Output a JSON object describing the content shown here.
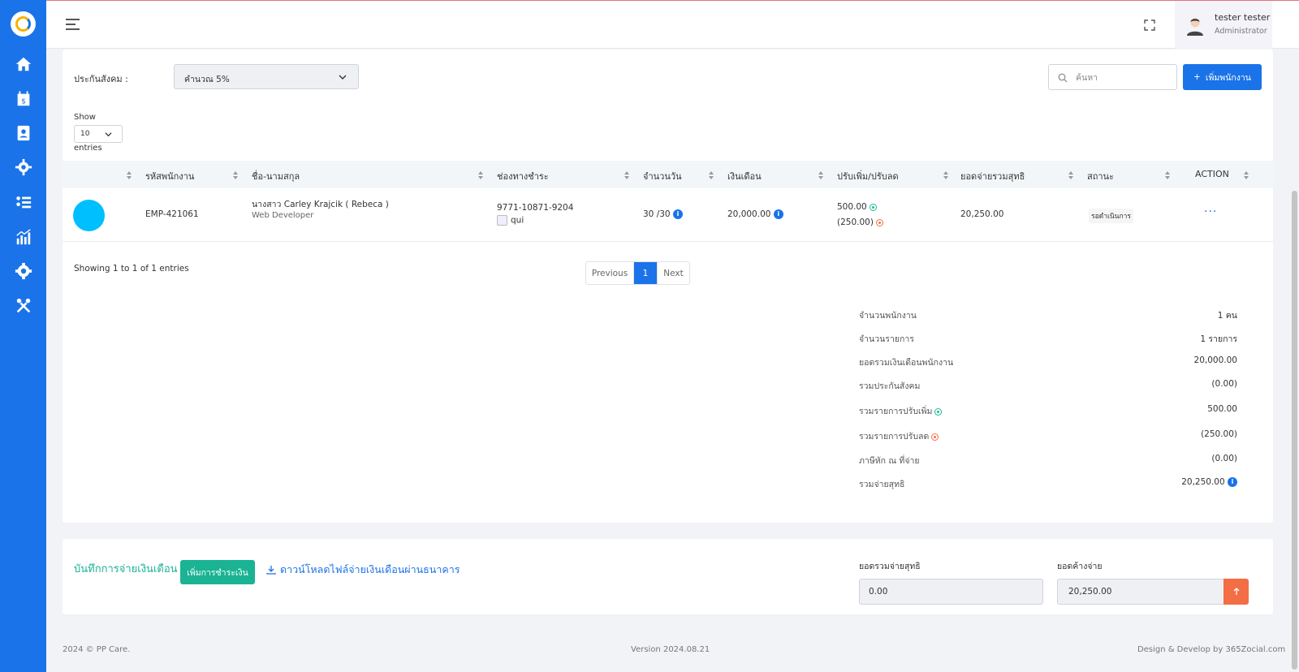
{
  "header": {
    "user_name": "tester tester",
    "user_role": "Administrator"
  },
  "sidebar": {
    "items": [
      {
        "icon": "home-icon"
      },
      {
        "icon": "salary-calendar-icon"
      },
      {
        "icon": "contacts-icon"
      },
      {
        "icon": "gears-icon"
      },
      {
        "icon": "list-users-icon"
      },
      {
        "icon": "chart-icon"
      },
      {
        "icon": "settings-icon"
      },
      {
        "icon": "tools-icon"
      }
    ]
  },
  "filters": {
    "social_security_label": "ประกันสังคม :",
    "social_security_value": "คำนวณ 5%",
    "search_placeholder": "ค้นหา",
    "add_employee_label": "เพิ่มพนักงาน",
    "show_label": "Show",
    "entries_value": "10",
    "entries_label": "entries"
  },
  "table": {
    "columns": [
      "",
      "รหัสพนักงาน",
      "ชื่อ-นามสกุล",
      "ช่องทางชำระ",
      "จำนวนวัน",
      "เงินเดือน",
      "ปรับเพิ่ม/ปรับลด",
      "ยอดจ่ายรวมสุทธิ",
      "สถานะ",
      "ACTION"
    ],
    "rows": [
      {
        "emp_code": "EMP-421061",
        "name": "นางสาว Carley Krajcik ( Rebeca )",
        "position": "Web Developer",
        "account": "9771-10871-9204",
        "bank": "qui",
        "days": "30 /30",
        "salary": "20,000.00",
        "increase": "500.00",
        "decrease": "(250.00)",
        "net": "20,250.00",
        "status": "รอดำเนินการ",
        "action": "···"
      }
    ]
  },
  "pagination": {
    "showing": "Showing 1 to 1 of 1 entries",
    "previous": "Previous",
    "current": "1",
    "next": "Next"
  },
  "summary": [
    {
      "label": "จำนวนพนักงาน",
      "value": "1 คน"
    },
    {
      "label": "จำนวนรายการ",
      "value": "1 รายการ"
    },
    {
      "label": "ยอดรวมเงินเดือนพนักงาน",
      "value": "20,000.00"
    },
    {
      "label": "รวมประกันสังคม",
      "value": "(0.00)"
    },
    {
      "label": "รวมรายการปรับเพิ่ม",
      "value": "500.00"
    },
    {
      "label": "รวมรายการปรับลด",
      "value": "(250.00)"
    },
    {
      "label": "ภาษีหัก ณ ที่จ่าย",
      "value": "(0.00)"
    },
    {
      "label": "รวมจ่ายสุทธิ",
      "value": "20,250.00"
    }
  ],
  "payment": {
    "title": "บันทึกการจ่ายเงินเดือน",
    "add_payment_label": "เพิ่มการชำระเงิน",
    "download_label": "ดาวน์โหลดไฟล์จ่ายเงินเดือนผ่านธนาคาร",
    "total_paid_label": "ยอดรวมจ่ายสุทธิ",
    "total_paid_value": "0.00",
    "outstanding_label": "ยอดค้างจ่าย",
    "outstanding_value": "20,250.00"
  },
  "footer": {
    "copyright": "2024 © PP Care.",
    "version": "Version 2024.08.21",
    "credit": "Design & Develop by 365Zocial.com"
  },
  "colors": {
    "primary": "#1a73e8",
    "success": "#1ab394",
    "danger": "#f36d45",
    "avatar": "#00bfff"
  }
}
